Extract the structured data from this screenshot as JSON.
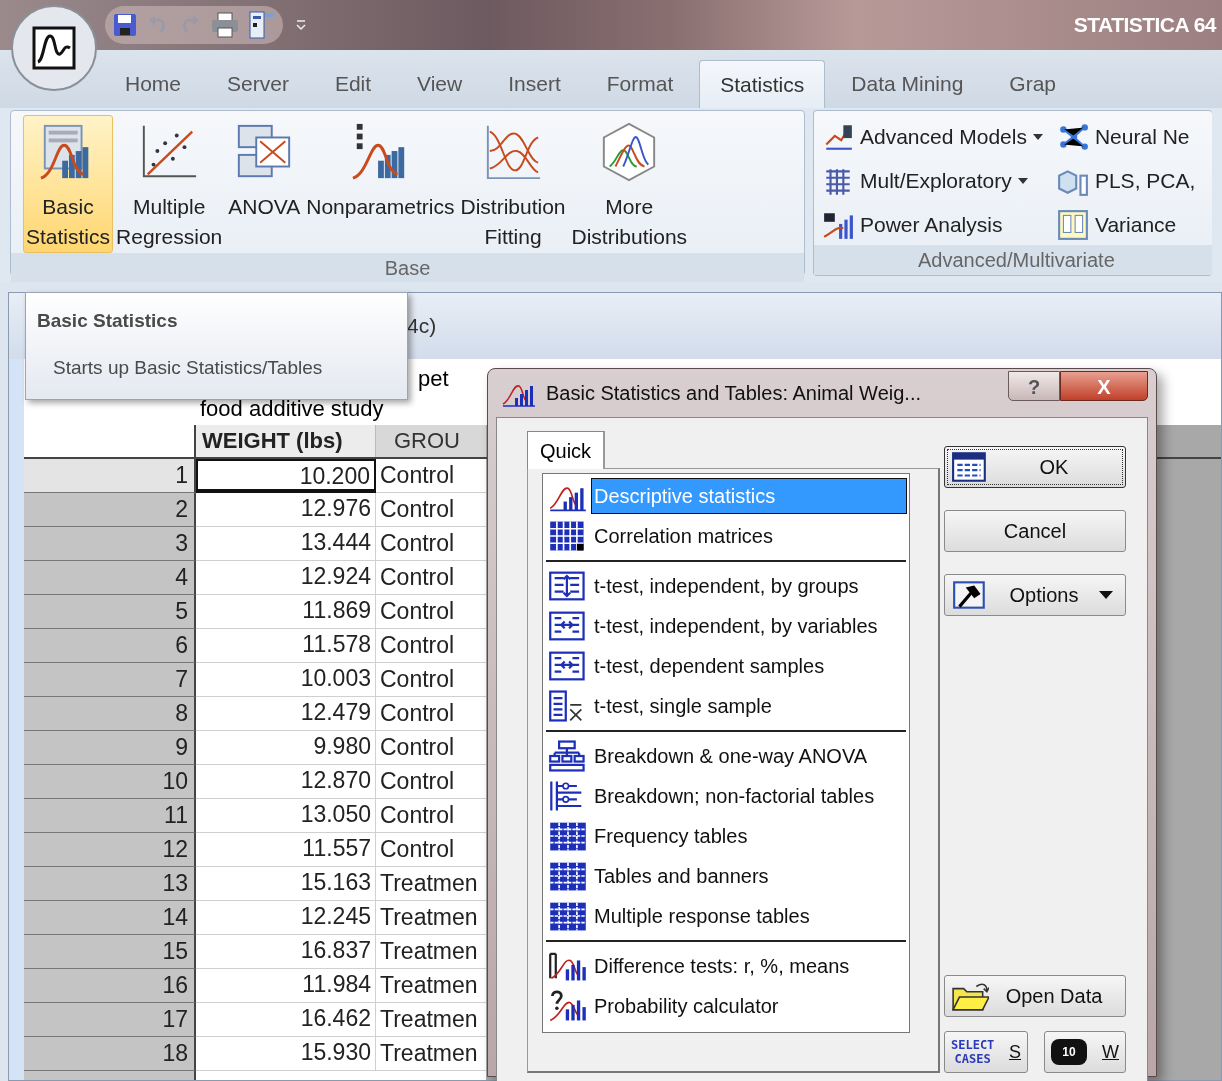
{
  "app_title": "STATISTICA 64",
  "ribbon_tabs": [
    {
      "label": "Home",
      "selected": false
    },
    {
      "label": "Server",
      "selected": false
    },
    {
      "label": "Edit",
      "selected": false
    },
    {
      "label": "View",
      "selected": false
    },
    {
      "label": "Insert",
      "selected": false
    },
    {
      "label": "Format",
      "selected": false
    },
    {
      "label": "Statistics",
      "selected": true
    },
    {
      "label": "Data Mining",
      "selected": false
    },
    {
      "label": "Grap",
      "selected": false
    }
  ],
  "ribbon_groups": [
    {
      "kind": "large",
      "label": "Base",
      "buttons": [
        {
          "label": "Basic\nStatistics",
          "kind": "basic",
          "hover": true
        },
        {
          "label": "Multiple\nRegression",
          "kind": "regression",
          "hover": false
        },
        {
          "label": "ANOVA",
          "kind": "anova",
          "hover": false
        },
        {
          "label": "Nonparametrics",
          "kind": "nonparam",
          "hover": false
        },
        {
          "label": "Distribution\nFitting",
          "kind": "fitting",
          "hover": false
        },
        {
          "label": "More\nDistributions",
          "kind": "more",
          "hover": false
        }
      ]
    },
    {
      "kind": "small",
      "label": "Advanced/Multivariate",
      "columns": [
        [
          {
            "label": "Advanced Models",
            "kind": "models",
            "dropdown": true
          },
          {
            "label": "Mult/Exploratory",
            "kind": "mult",
            "dropdown": true
          },
          {
            "label": "Power Analysis",
            "kind": "power",
            "dropdown": false
          }
        ],
        [
          {
            "label": "Neural Ne",
            "kind": "neural",
            "dropdown": false
          },
          {
            "label": "PLS, PCA,",
            "kind": "pls",
            "dropdown": false
          },
          {
            "label": "Variance",
            "kind": "variance",
            "dropdown": false
          }
        ]
      ]
    }
  ],
  "tooltip": {
    "title": "Basic Statistics",
    "text": "Starts up Basic Statistics/Tables"
  },
  "spreadsheet": {
    "title_fragment": "4c)",
    "note_lines": [
      "pet",
      "food additive study"
    ],
    "columns": [
      "WEIGHT (lbs)",
      "GROU"
    ],
    "rows": [
      {
        "case": "1",
        "weight": "10.200",
        "group": "Control",
        "current": true
      },
      {
        "case": "2",
        "weight": "12.976",
        "group": "Control",
        "current": false
      },
      {
        "case": "3",
        "weight": "13.444",
        "group": "Control",
        "current": false
      },
      {
        "case": "4",
        "weight": "12.924",
        "group": "Control",
        "current": false
      },
      {
        "case": "5",
        "weight": "11.869",
        "group": "Control",
        "current": false
      },
      {
        "case": "6",
        "weight": "11.578",
        "group": "Control",
        "current": false
      },
      {
        "case": "7",
        "weight": "10.003",
        "group": "Control",
        "current": false
      },
      {
        "case": "8",
        "weight": "12.479",
        "group": "Control",
        "current": false
      },
      {
        "case": "9",
        "weight": "9.980",
        "group": "Control",
        "current": false
      },
      {
        "case": "10",
        "weight": "12.870",
        "group": "Control",
        "current": false
      },
      {
        "case": "11",
        "weight": "13.050",
        "group": "Control",
        "current": false
      },
      {
        "case": "12",
        "weight": "11.557",
        "group": "Control",
        "current": false
      },
      {
        "case": "13",
        "weight": "15.163",
        "group": "Treatmen",
        "current": false
      },
      {
        "case": "14",
        "weight": "12.245",
        "group": "Treatmen",
        "current": false
      },
      {
        "case": "15",
        "weight": "16.837",
        "group": "Treatmen",
        "current": false
      },
      {
        "case": "16",
        "weight": "11.984",
        "group": "Treatmen",
        "current": false
      },
      {
        "case": "17",
        "weight": "16.462",
        "group": "Treatmen",
        "current": false
      },
      {
        "case": "18",
        "weight": "15.930",
        "group": "Treatmen",
        "current": false
      }
    ]
  },
  "dialog": {
    "title": "Basic Statistics and Tables: Animal Weig...",
    "help": "?",
    "close": "X",
    "tabs": [
      {
        "label": "Quick",
        "selected": true
      }
    ],
    "list_sections": [
      [
        {
          "label": "Descriptive statistics",
          "kind": "desc",
          "selected": true
        },
        {
          "label": "Correlation matrices",
          "kind": "corr",
          "selected": false
        }
      ],
      [
        {
          "label": "t-test, independent, by groups",
          "kind": "tgroups",
          "selected": false
        },
        {
          "label": "t-test, independent, by variables",
          "kind": "tvars",
          "selected": false
        },
        {
          "label": "t-test, dependent samples",
          "kind": "tvars",
          "selected": false
        },
        {
          "label": "t-test, single sample",
          "kind": "tsingle",
          "selected": false
        }
      ],
      [
        {
          "label": "Breakdown & one-way ANOVA",
          "kind": "breakdown",
          "selected": false
        },
        {
          "label": "Breakdown; non-factorial tables",
          "kind": "breaktables",
          "selected": false
        },
        {
          "label": "Frequency tables",
          "kind": "grid",
          "selected": false
        },
        {
          "label": "Tables and banners",
          "kind": "grid",
          "selected": false
        },
        {
          "label": "Multiple response tables",
          "kind": "grid",
          "selected": false
        }
      ],
      [
        {
          "label": "Difference tests: r, %, means",
          "kind": "diff",
          "selected": false
        },
        {
          "label": "Probability calculator",
          "kind": "prob",
          "selected": false
        }
      ]
    ],
    "buttons": [
      {
        "label": "OK",
        "kind": "table",
        "default": true
      },
      {
        "label": "Cancel",
        "kind": "plain",
        "default": false
      },
      {
        "label": "Options",
        "kind": "hammer",
        "dropdown": true,
        "default": false
      }
    ],
    "bottom_buttons": [
      {
        "label": "Open Data",
        "kind": "folder",
        "default": false
      }
    ],
    "small_buttons": [
      {
        "icon_text": "SELECT\nCASES",
        "label": "S"
      },
      {
        "icon_text": "10",
        "label": "W"
      }
    ]
  }
}
